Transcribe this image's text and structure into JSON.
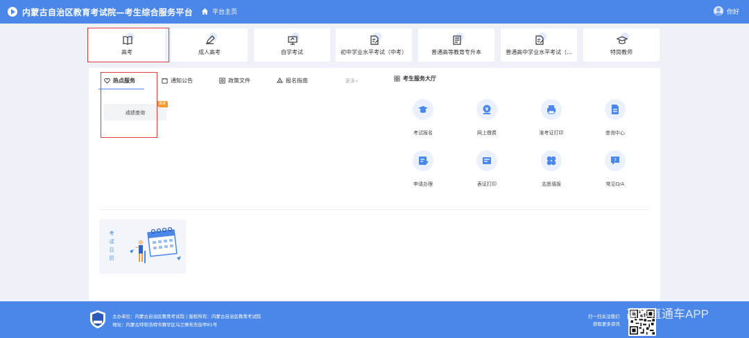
{
  "header": {
    "title": "内蒙古自治区教育考试院—考生综合服务平台",
    "home_label": "平台主页",
    "user_greeting": "你好"
  },
  "categories": [
    {
      "label": "高考",
      "icon": "book-icon"
    },
    {
      "label": "成人高考",
      "icon": "pen-icon"
    },
    {
      "label": "自学考试",
      "icon": "monitor-icon"
    },
    {
      "label": "初中学业水平考试（中考）",
      "icon": "edit-doc-icon"
    },
    {
      "label": "普通高等教育专升本",
      "icon": "document-icon"
    },
    {
      "label": "普通高中学业水平考试（...",
      "icon": "edit-doc-icon"
    },
    {
      "label": "特岗教师",
      "icon": "graduation-cap-icon"
    }
  ],
  "tabs": [
    {
      "label": "热点服务",
      "icon": "hot-icon"
    },
    {
      "label": "通知公告",
      "icon": "notice-icon"
    },
    {
      "label": "政策文件",
      "icon": "policy-icon"
    },
    {
      "label": "报名指南",
      "icon": "guide-icon"
    }
  ],
  "more_label": "更多»",
  "hall_title": "考生服务大厅",
  "hot_services": [
    {
      "label": "成绩查询",
      "badge": "高考"
    }
  ],
  "services": [
    {
      "label": "考试报名",
      "icon": "graduation-cap-icon"
    },
    {
      "label": "网上缴费",
      "icon": "coin-icon"
    },
    {
      "label": "准考证打印",
      "icon": "printer-icon"
    },
    {
      "label": "查询中心",
      "icon": "file-search-icon"
    },
    {
      "label": "申请办理",
      "icon": "form-icon"
    },
    {
      "label": "表证打印",
      "icon": "print-doc-icon"
    },
    {
      "label": "志愿填报",
      "icon": "clover-icon"
    },
    {
      "label": "常见Q/A",
      "icon": "question-icon"
    }
  ],
  "calendar_card": {
    "label": "考试日历"
  },
  "footer": {
    "sponsor": "主办单位：内蒙古自治区教育考试院 | 版权所有：内蒙古自治区教育考试院",
    "address": "地址：内蒙古呼和浩特市赛罕区乌兰察布东街甲81号",
    "scan_line1": "扫一扫关注我们",
    "scan_line2": "获取更多资讯",
    "watermark": "高考直通车APP"
  },
  "colors": {
    "primary": "#4a87e8",
    "badge": "#f39a2e",
    "annotation": "#e03b3b"
  }
}
